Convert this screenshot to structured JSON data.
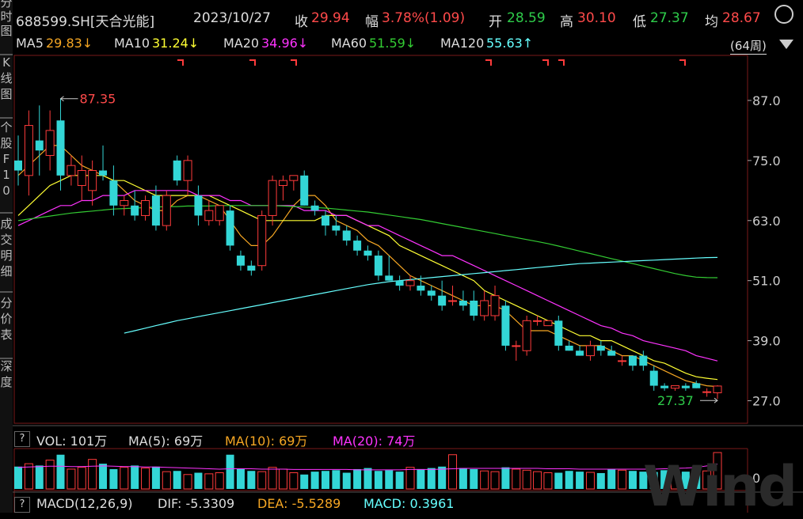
{
  "sidebar": {
    "items": [
      "分",
      "时",
      "图",
      "K",
      "线",
      "图",
      "个",
      "股",
      "F",
      "1",
      "0",
      "成",
      "交",
      "明",
      "细",
      "分",
      "价",
      "表",
      "深",
      "度"
    ]
  },
  "header": {
    "code": "688599.SH[天合光能]",
    "date": "2023/10/27",
    "close_label": "收",
    "close": "29.94",
    "change_label": "幅",
    "change": "3.78%(1.09)",
    "open_label": "开",
    "open": "28.59",
    "high_label": "高",
    "high": "30.10",
    "low_label": "低",
    "low": "27.37",
    "avg_label": "均",
    "avg": "28.67"
  },
  "ma_legend": [
    {
      "label": "MA5",
      "value": "29.83↓",
      "color": "#f5a623"
    },
    {
      "label": "MA10",
      "value": "31.24↓",
      "color": "#ffff33"
    },
    {
      "label": "MA20",
      "value": "34.96↓",
      "color": "#ff33ff"
    },
    {
      "label": "MA60",
      "value": "51.59↓",
      "color": "#33cc33"
    },
    {
      "label": "MA120",
      "value": "55.63↑",
      "color": "#66ffff"
    }
  ],
  "period": "(64周)",
  "volume_legend": {
    "q": "?",
    "vol": "VOL: 101万",
    "ma5": "MA(5): 69万",
    "ma10": "MA(10): 69万",
    "ma20": "MA(20): 74万"
  },
  "macd_legend": {
    "q": "?",
    "title": "MACD(12,26,9)",
    "dif": "DIF: -5.3309",
    "dea": "DEA: -5.5289",
    "macd": "MACD: 0.3961"
  },
  "watermark": "Wind",
  "colors": {
    "up": "#ff3b3b",
    "down": "#33d6d6",
    "grid": "#7a1a1a"
  },
  "chart_data": {
    "type": "candlestick",
    "price_axis": {
      "ticks": [
        87.0,
        75.0,
        63.0,
        51.0,
        39.0,
        27.0
      ],
      "range": [
        22.5,
        96.0
      ]
    },
    "annotations": {
      "high": "87.35",
      "low": "27.37"
    },
    "volume_axis": {
      "ticks": [
        "0"
      ]
    },
    "candles": [
      {
        "o": 75,
        "h": 80,
        "l": 70,
        "c": 73
      },
      {
        "o": 72,
        "h": 85,
        "l": 68,
        "c": 82
      },
      {
        "o": 79,
        "h": 86,
        "l": 72,
        "c": 77
      },
      {
        "o": 76,
        "h": 85,
        "l": 73,
        "c": 81
      },
      {
        "o": 83,
        "h": 87.35,
        "l": 69,
        "c": 72
      },
      {
        "o": 72,
        "h": 76,
        "l": 70,
        "c": 74
      },
      {
        "o": 70,
        "h": 76,
        "l": 67,
        "c": 73
      },
      {
        "o": 69,
        "h": 75,
        "l": 66,
        "c": 73
      },
      {
        "o": 73,
        "h": 78,
        "l": 71,
        "c": 72
      },
      {
        "o": 71,
        "h": 74,
        "l": 64,
        "c": 66
      },
      {
        "o": 66,
        "h": 68,
        "l": 64,
        "c": 67
      },
      {
        "o": 66,
        "h": 69,
        "l": 63,
        "c": 64
      },
      {
        "o": 64,
        "h": 68,
        "l": 63,
        "c": 67
      },
      {
        "o": 68,
        "h": 70,
        "l": 61,
        "c": 62
      },
      {
        "o": 62,
        "h": 69,
        "l": 61,
        "c": 68
      },
      {
        "o": 75,
        "h": 76,
        "l": 70,
        "c": 71
      },
      {
        "o": 71,
        "h": 76,
        "l": 68,
        "c": 75
      },
      {
        "o": 68,
        "h": 70,
        "l": 62,
        "c": 64
      },
      {
        "o": 63,
        "h": 67,
        "l": 62,
        "c": 65
      },
      {
        "o": 63,
        "h": 66,
        "l": 62,
        "c": 66
      },
      {
        "o": 65,
        "h": 66,
        "l": 57,
        "c": 58
      },
      {
        "o": 56,
        "h": 57,
        "l": 53,
        "c": 54
      },
      {
        "o": 54,
        "h": 55,
        "l": 52,
        "c": 53
      },
      {
        "o": 54,
        "h": 65,
        "l": 53,
        "c": 64
      },
      {
        "o": 64,
        "h": 72,
        "l": 62,
        "c": 71
      },
      {
        "o": 70,
        "h": 72,
        "l": 67,
        "c": 71
      },
      {
        "o": 71,
        "h": 72,
        "l": 69,
        "c": 72
      },
      {
        "o": 72,
        "h": 73,
        "l": 66,
        "c": 66
      },
      {
        "o": 66,
        "h": 67,
        "l": 64,
        "c": 65
      },
      {
        "o": 64,
        "h": 65,
        "l": 60,
        "c": 62
      },
      {
        "o": 62,
        "h": 64,
        "l": 60,
        "c": 61
      },
      {
        "o": 61,
        "h": 62,
        "l": 58,
        "c": 59
      },
      {
        "o": 59,
        "h": 60,
        "l": 56,
        "c": 57
      },
      {
        "o": 57,
        "h": 58,
        "l": 55,
        "c": 56
      },
      {
        "o": 56,
        "h": 57,
        "l": 51,
        "c": 52
      },
      {
        "o": 52,
        "h": 56,
        "l": 51,
        "c": 51
      },
      {
        "o": 51,
        "h": 52,
        "l": 49,
        "c": 50
      },
      {
        "o": 50,
        "h": 52,
        "l": 49,
        "c": 51
      },
      {
        "o": 50,
        "h": 52,
        "l": 48,
        "c": 49
      },
      {
        "o": 49,
        "h": 50,
        "l": 47,
        "c": 48
      },
      {
        "o": 48,
        "h": 51,
        "l": 45,
        "c": 46
      },
      {
        "o": 47,
        "h": 50,
        "l": 46,
        "c": 47
      },
      {
        "o": 47,
        "h": 49,
        "l": 45,
        "c": 46
      },
      {
        "o": 47,
        "h": 49,
        "l": 43,
        "c": 44
      },
      {
        "o": 44,
        "h": 49,
        "l": 43,
        "c": 47
      },
      {
        "o": 44,
        "h": 50,
        "l": 43,
        "c": 48
      },
      {
        "o": 46,
        "h": 47,
        "l": 37,
        "c": 38
      },
      {
        "o": 38,
        "h": 39,
        "l": 35,
        "c": 38
      },
      {
        "o": 37,
        "h": 44,
        "l": 36,
        "c": 43
      },
      {
        "o": 43,
        "h": 44,
        "l": 42,
        "c": 43
      },
      {
        "o": 42,
        "h": 43,
        "l": 42,
        "c": 43
      },
      {
        "o": 43,
        "h": 44,
        "l": 37,
        "c": 38
      },
      {
        "o": 38,
        "h": 39,
        "l": 37,
        "c": 37
      },
      {
        "o": 37,
        "h": 38,
        "l": 36,
        "c": 36
      },
      {
        "o": 36,
        "h": 39,
        "l": 35,
        "c": 38
      },
      {
        "o": 38,
        "h": 39,
        "l": 36,
        "c": 37
      },
      {
        "o": 37,
        "h": 38,
        "l": 36,
        "c": 36
      },
      {
        "o": 35,
        "h": 36,
        "l": 34,
        "c": 35
      },
      {
        "o": 36,
        "h": 36,
        "l": 33,
        "c": 34
      },
      {
        "o": 36,
        "h": 37,
        "l": 33,
        "c": 34
      },
      {
        "o": 33,
        "h": 34,
        "l": 29,
        "c": 30
      },
      {
        "o": 30,
        "h": 30.5,
        "l": 29,
        "c": 29.5
      },
      {
        "o": 29.5,
        "h": 30,
        "l": 29,
        "c": 30
      },
      {
        "o": 30,
        "h": 30.5,
        "l": 29,
        "c": 29.5
      },
      {
        "o": 30.5,
        "h": 31,
        "l": 29.5,
        "c": 29.5
      },
      {
        "o": 28.8,
        "h": 29.5,
        "l": 27.8,
        "c": 28.8
      },
      {
        "o": 28.59,
        "h": 30.1,
        "l": 27.37,
        "c": 29.94
      }
    ],
    "ma_series": {
      "MA5": [
        72,
        74,
        76,
        78,
        78,
        76,
        74,
        73,
        72,
        71,
        69,
        67,
        66,
        65,
        65,
        67,
        68,
        68,
        67,
        66,
        63,
        60,
        58,
        58,
        60,
        63,
        66,
        68,
        68,
        66,
        63,
        62,
        61,
        59,
        58,
        56,
        54,
        52,
        51,
        50,
        49,
        48,
        47,
        46,
        46,
        46,
        45,
        43,
        41,
        41,
        41,
        40,
        39,
        38,
        38,
        38,
        37,
        36,
        36,
        35,
        34,
        33,
        32,
        31,
        30.5,
        30,
        29.83
      ],
      "MA10": [
        64,
        66,
        68,
        70,
        71,
        72,
        72,
        72,
        72,
        71,
        71,
        70,
        69,
        68,
        68,
        68,
        68,
        68,
        68,
        67,
        66,
        65,
        64,
        63,
        63,
        63,
        63,
        63,
        63,
        64,
        64,
        64,
        63,
        62,
        61,
        60,
        58,
        57,
        56,
        55,
        54,
        53,
        52,
        51,
        49,
        48,
        47,
        46,
        45,
        44,
        43,
        42,
        41,
        40,
        40,
        39,
        39,
        38,
        37,
        36,
        35,
        34.5,
        33.5,
        32.5,
        31.8,
        31.5,
        31.24
      ],
      "MA20": [
        62,
        63,
        64,
        65,
        66,
        66,
        67,
        67,
        68,
        68,
        68,
        69,
        69,
        69,
        69,
        69,
        69,
        68,
        68,
        68,
        67,
        67,
        66,
        66,
        66,
        66,
        66,
        65,
        65,
        65,
        64,
        64,
        63,
        62,
        62,
        61,
        60,
        59,
        58,
        57,
        56,
        56,
        55,
        54,
        53,
        52,
        51,
        50,
        49,
        48,
        47,
        46,
        45,
        44,
        43,
        42,
        41.5,
        40.5,
        40,
        39,
        38.5,
        38,
        37.5,
        37,
        36,
        35.5,
        34.96
      ],
      "MA60": [
        63,
        63.3,
        63.6,
        63.9,
        64.2,
        64.5,
        64.7,
        64.9,
        65.1,
        65.3,
        65.4,
        65.5,
        65.6,
        65.7,
        65.8,
        65.8,
        65.9,
        65.9,
        65.9,
        66,
        66,
        66,
        66,
        66,
        66,
        65.9,
        65.8,
        65.7,
        65.6,
        65.5,
        65.3,
        65.1,
        64.9,
        64.7,
        64.4,
        64.1,
        63.8,
        63.5,
        63.2,
        62.8,
        62.4,
        62,
        61.6,
        61.2,
        60.8,
        60.4,
        60,
        59.6,
        59.2,
        58.8,
        58.4,
        57.9,
        57.4,
        56.9,
        56.4,
        55.9,
        55.4,
        54.9,
        54.4,
        53.9,
        53.4,
        52.9,
        52.4,
        52,
        51.7,
        51.6,
        51.59
      ],
      "MA120": [
        null,
        null,
        null,
        null,
        null,
        null,
        null,
        null,
        null,
        null,
        40.5,
        41,
        41.5,
        42,
        42.5,
        43,
        43.4,
        43.8,
        44.2,
        44.6,
        45,
        45.4,
        45.8,
        46.2,
        46.6,
        47,
        47.4,
        47.8,
        48.2,
        48.6,
        49,
        49.4,
        49.8,
        50.2,
        50.5,
        50.8,
        51,
        51.2,
        51.4,
        51.6,
        51.8,
        52,
        52.2,
        52.4,
        52.6,
        52.8,
        53,
        53.2,
        53.4,
        53.6,
        53.8,
        54,
        54.2,
        54.4,
        54.5,
        54.6,
        54.7,
        54.8,
        54.9,
        55,
        55.1,
        55.2,
        55.3,
        55.4,
        55.5,
        55.6,
        55.63
      ]
    },
    "volume": [
      62,
      70,
      65,
      80,
      95,
      55,
      60,
      82,
      70,
      55,
      60,
      65,
      58,
      62,
      48,
      50,
      40,
      45,
      42,
      45,
      95,
      55,
      50,
      48,
      60,
      55,
      45,
      40,
      48,
      50,
      52,
      45,
      55,
      58,
      50,
      52,
      48,
      60,
      55,
      58,
      62,
      95,
      58,
      55,
      50,
      48,
      60,
      55,
      52,
      48,
      45,
      45,
      50,
      48,
      46,
      44,
      55,
      52,
      50,
      48,
      47,
      52,
      50,
      48,
      46,
      50,
      101
    ],
    "volume_ma": [
      60,
      61,
      62,
      63,
      63,
      62,
      62,
      63,
      64,
      63,
      62,
      62,
      61,
      61,
      60,
      59,
      58,
      57,
      56,
      55,
      56,
      56,
      56,
      55,
      55,
      55,
      54,
      54,
      54,
      54,
      54,
      54,
      53,
      53,
      53,
      53,
      53,
      54,
      54,
      54,
      55,
      56,
      57,
      57,
      57,
      57,
      57,
      57,
      57,
      57,
      56,
      56,
      56,
      55,
      55,
      55,
      55,
      55,
      55,
      55,
      55,
      56,
      57,
      58,
      60,
      64,
      69
    ]
  }
}
